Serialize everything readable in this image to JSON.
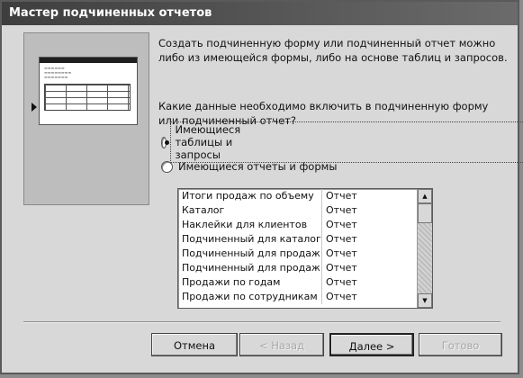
{
  "window": {
    "title": "Мастер подчиненных отчетов"
  },
  "intro": "Создать подчиненную форму или подчиненный отчет можно либо из имеющейся формы, либо на основе таблиц и запросов.",
  "question": "Какие данные необходимо включить в подчиненную форму или подчиненный отчет?",
  "options": [
    {
      "label": "Имеющиеся таблицы и запросы",
      "checked": true
    },
    {
      "label": "Имеющиеся отчеты и формы",
      "checked": false
    }
  ],
  "list": {
    "rows": [
      {
        "name": "Итоги продаж по объему",
        "type": "Отчет"
      },
      {
        "name": "Каталог",
        "type": "Отчет"
      },
      {
        "name": "Наклейки для клиентов",
        "type": "Отчет"
      },
      {
        "name": "Подчиненный для каталога",
        "type": "Отчет"
      },
      {
        "name": "Подчиненный для продаж по",
        "type": "Отчет"
      },
      {
        "name": "Подчиненный для продаж по",
        "type": "Отчет"
      },
      {
        "name": "Продажи по годам",
        "type": "Отчет"
      },
      {
        "name": "Продажи по сотрудникам и",
        "type": "Отчет"
      }
    ]
  },
  "buttons": {
    "cancel": "Отмена",
    "back": "< Назад",
    "next": "Далее >",
    "finish": "Готово"
  },
  "icons": {
    "scroll_up": "scroll-up-arrow-icon",
    "scroll_down": "scroll-down-arrow-icon",
    "pointer": "pointer-arrow-icon"
  }
}
